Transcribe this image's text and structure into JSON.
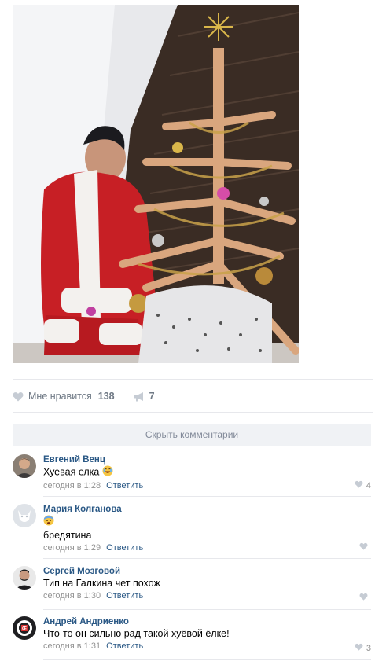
{
  "post": {
    "photo_alt": "",
    "likes": {
      "label": "Мне нравится",
      "count": "138"
    },
    "shares": {
      "count": "7"
    }
  },
  "comments_toggle": {
    "label": "Скрыть комментарии"
  },
  "comments": [
    {
      "author": "Евгений Венц",
      "text": "Хуевая елка",
      "emoji": "laughing-emoji",
      "time": "сегодня в 1:28",
      "reply": "Ответить",
      "likes": "4"
    },
    {
      "author": "Мария Колганова",
      "emoji_line": "fearful-emoji",
      "text": "бредятина",
      "time": "сегодня в 1:29",
      "reply": "Ответить",
      "likes": ""
    },
    {
      "author": "Сергей Мозговой",
      "text": "Тип на Галкина чет похож",
      "time": "сегодня в 1:30",
      "reply": "Ответить",
      "likes": ""
    },
    {
      "author": "Андрей Андриенко",
      "text": "Что-то он сильно рад такой хуёвой ёлке!",
      "time": "сегодня в 1:31",
      "reply": "Ответить",
      "likes": "3"
    }
  ],
  "colors": {
    "link": "#2a5885",
    "muted": "#939393",
    "toggle_bg": "#f0f2f5",
    "divider": "#e7e8ec"
  }
}
